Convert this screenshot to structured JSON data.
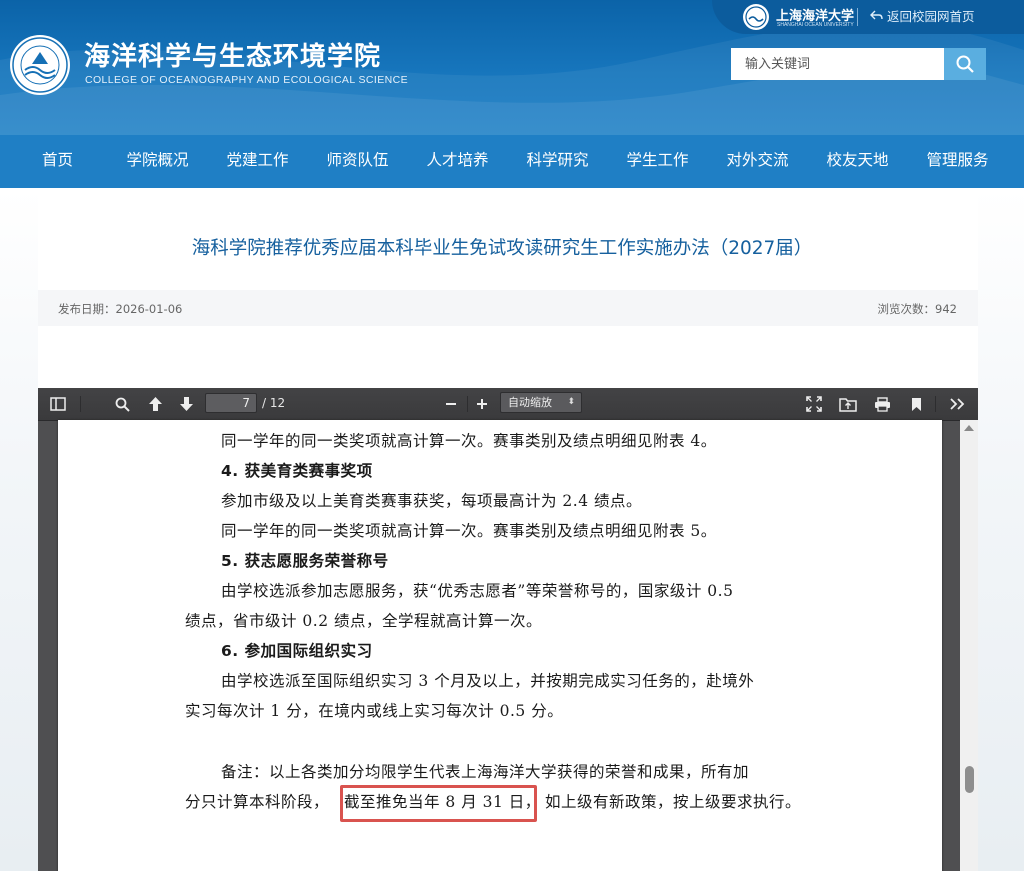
{
  "header": {
    "college_name_cn": "海洋科学与生态环境学院",
    "college_name_en": "COLLEGE OF  OCEANOGRAPHY AND ECOLOGICAL SCIENCE",
    "university_name": "上海海洋大学",
    "university_sub": "SHANGHAI OCEAN UNIVERSITY",
    "return_link": "返回校园网首页",
    "search_placeholder": "输入关键词",
    "colors": {
      "header_bg": "#1776bd",
      "nav_bg": "#1f7fc5",
      "title": "#16609e"
    }
  },
  "nav": {
    "items": [
      "首页",
      "学院概况",
      "党建工作",
      "师资队伍",
      "人才培养",
      "科学研究",
      "学生工作",
      "对外交流",
      "校友天地",
      "管理服务"
    ]
  },
  "article": {
    "title": "海科学院推荐优秀应届本科毕业生免试攻读研究生工作实施办法（2027届）",
    "publish_date": "发布日期：2026-01-06",
    "views": "浏览次数：942"
  },
  "pdf_viewer": {
    "current_page": "7",
    "total_pages": "/ 12",
    "zoom": "自动缩放",
    "content_lines": [
      "同一学年的同一类奖项就高计算一次。赛事类别及绩点明细见附表 4。",
      "4. 获美育类赛事奖项",
      "参加市级及以上美育类赛事获奖，每项最高计为 2.4 绩点。",
      "同一学年的同一类奖项就高计算一次。赛事类别及绩点明细见附表 5。",
      "5. 获志愿服务荣誉称号",
      "由学校选派参加志愿服务，获“优秀志愿者”等荣誉称号的，国家级计 0.5",
      "绩点，省市级计 0.2 绩点，全学程就高计算一次。",
      "6. 参加国际组织实习",
      "由学校选派至国际组织实习 3 个月及以上，并按期完成实习任务的，赴境外",
      "实习每次计 1 分，在境内或线上实习每次计 0.5 分。",
      "备注：以上各类加分均限学生代表上海海洋大学获得的荣誉和成果，所有加",
      "分只计算本科阶段，",
      "截至推免当年 8 月 31 日，",
      "如上级有新政策，按上级要求执行。"
    ],
    "highlight_color": "#d9534f"
  }
}
